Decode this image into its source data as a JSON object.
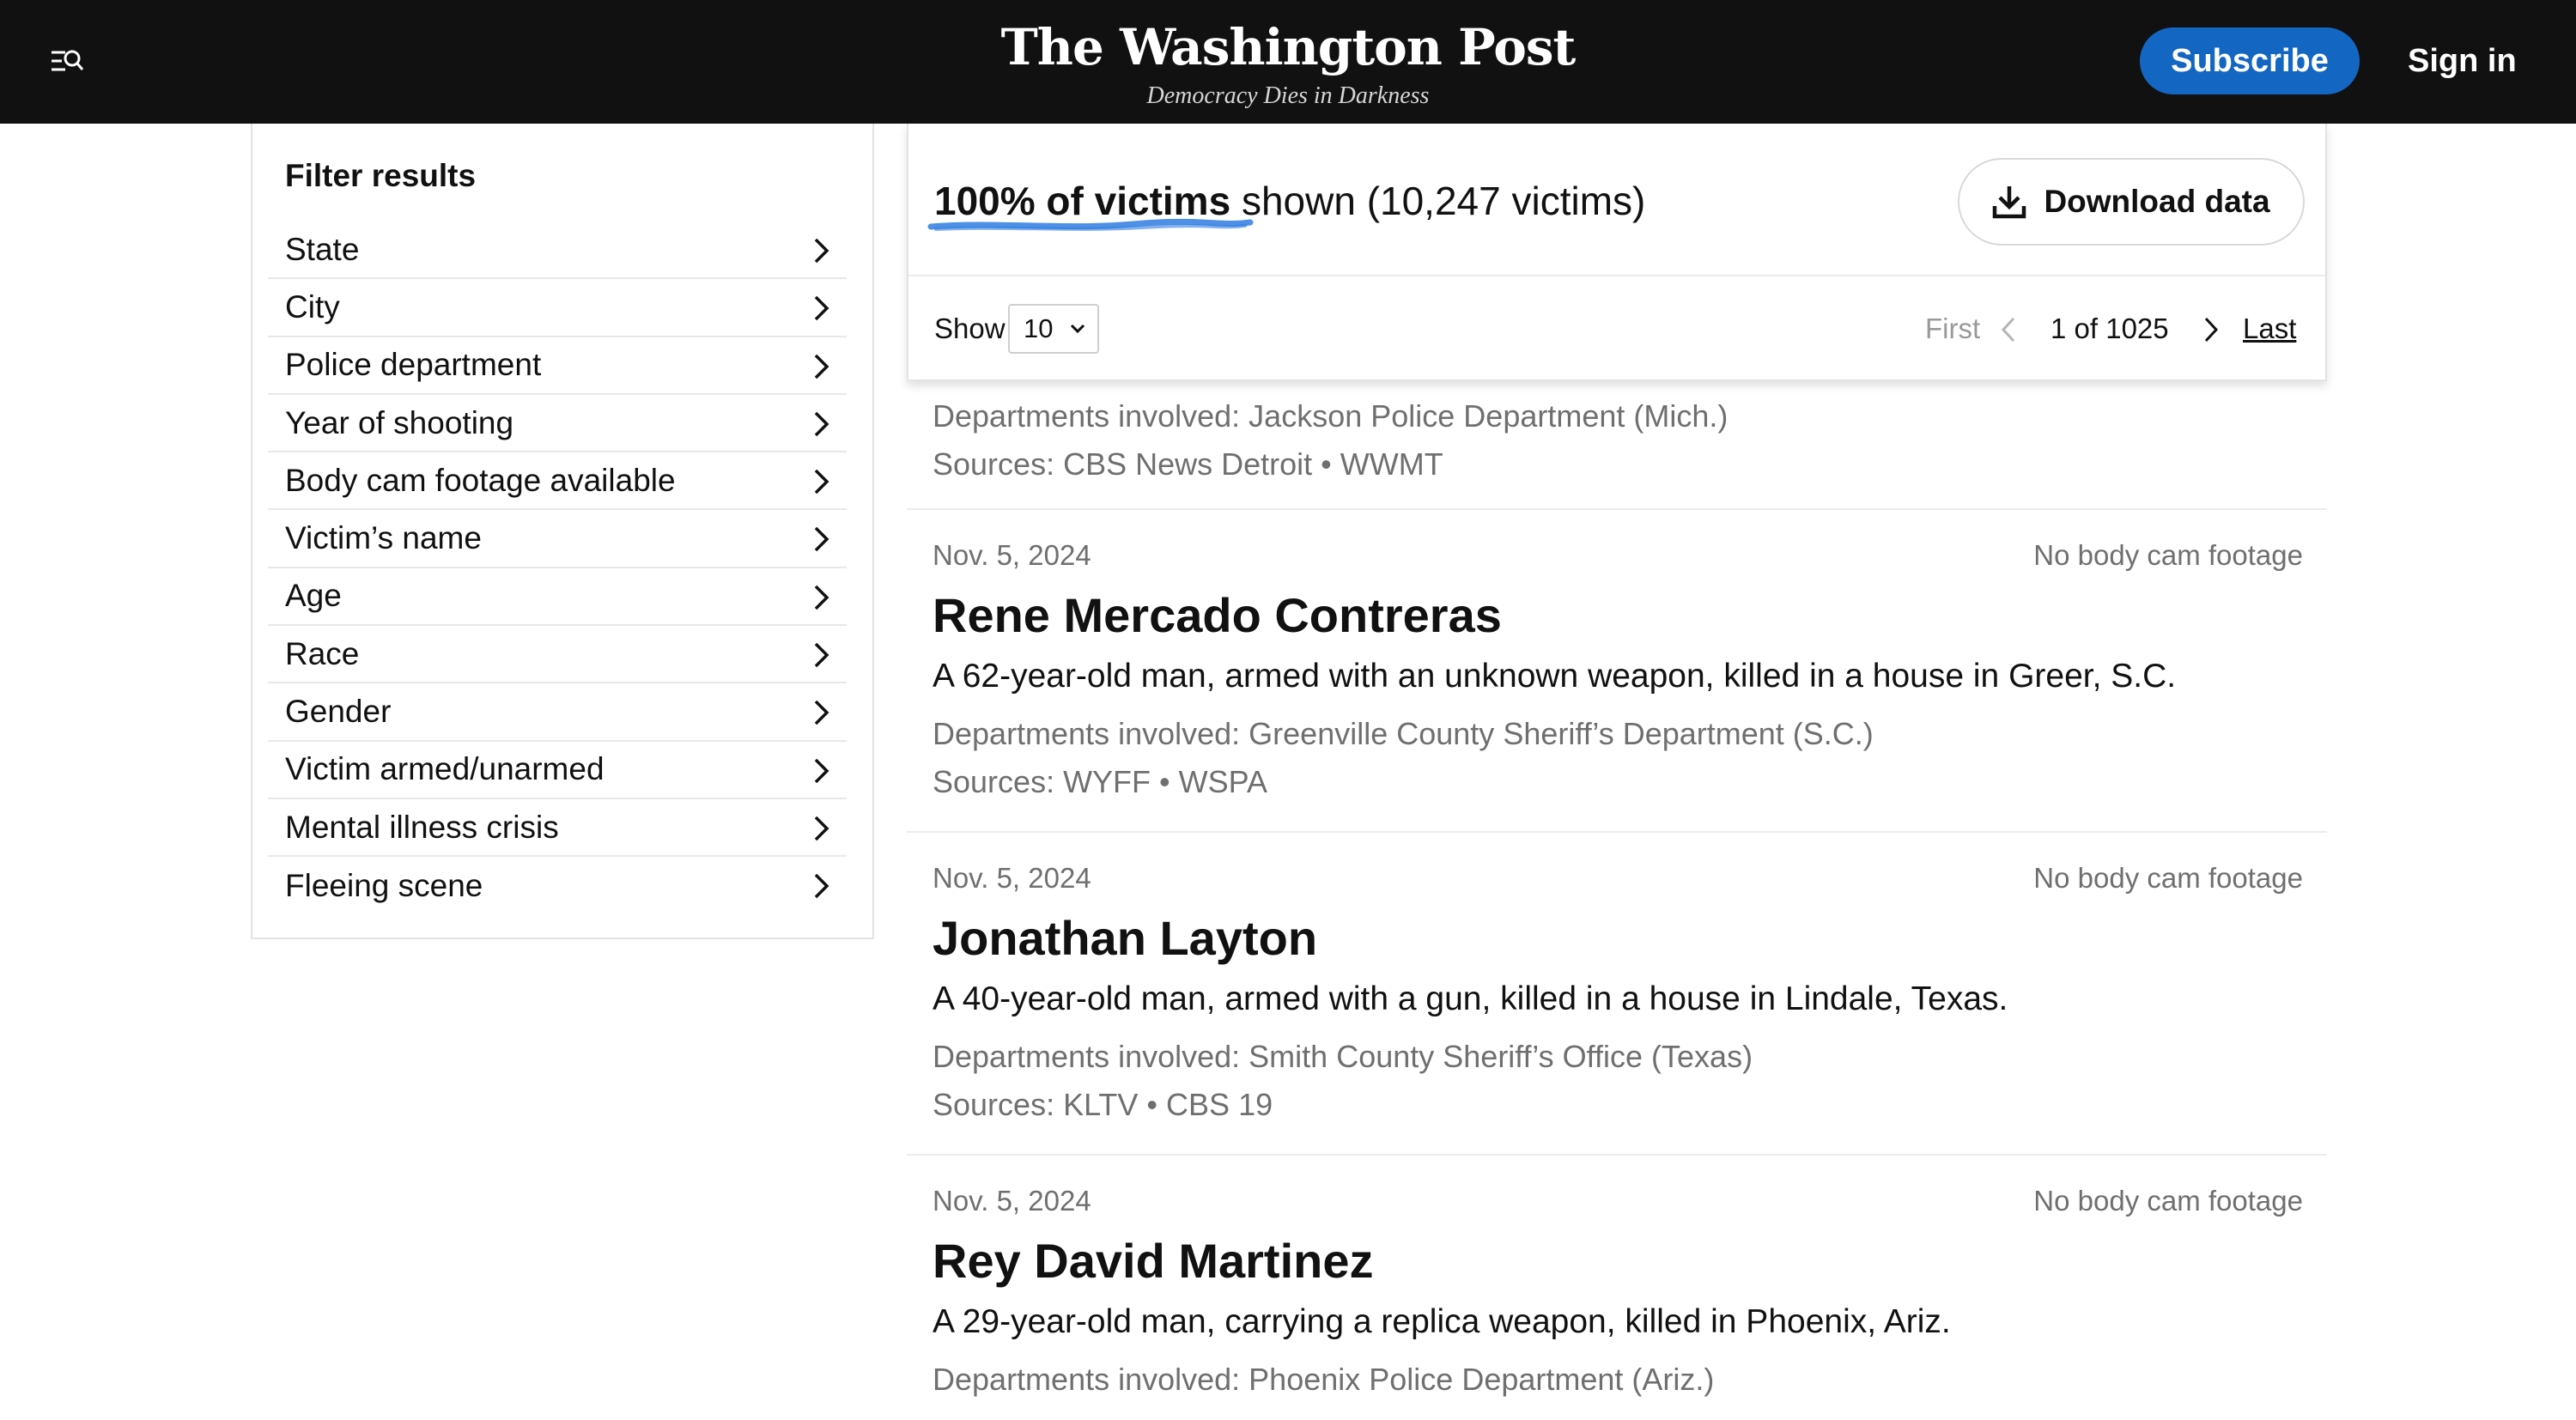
{
  "header": {
    "wordmark": "The Washington Post",
    "tagline": "Democracy Dies in Darkness",
    "subscribe_label": "Subscribe",
    "signin_label": "Sign in",
    "accent": "#1366c2"
  },
  "filters": {
    "title": "Filter results",
    "items": [
      "State",
      "City",
      "Police department",
      "Year of shooting",
      "Body cam footage available",
      "Victim’s name",
      "Age",
      "Race",
      "Gender",
      "Victim armed/unarmed",
      "Mental illness crisis",
      "Fleeing scene"
    ]
  },
  "summary": {
    "pct_label": "100% of victims",
    "shown_text": " shown (10,247 victims)",
    "download_label": "Download data",
    "show_label": "Show",
    "show_value": "10",
    "first_label": "First",
    "page_status": "1 of 1025",
    "last_label": "Last"
  },
  "partial_entry": {
    "departments": "Departments involved: Jackson Police Department (Mich.)",
    "sources": "Sources: CBS News Detroit • WWMT"
  },
  "entries": [
    {
      "date": "Nov. 5, 2024",
      "body_cam": "No body cam footage",
      "name": "Rene Mercado Contreras",
      "description": "A 62-year-old man, armed with an unknown weapon, killed in a house in Greer, S.C.",
      "departments": "Departments involved: Greenville County Sheriff’s Department (S.C.)",
      "sources": "Sources: WYFF • WSPA"
    },
    {
      "date": "Nov. 5, 2024",
      "body_cam": "No body cam footage",
      "name": "Jonathan Layton",
      "description": "A 40-year-old man, armed with a gun, killed in a house in Lindale, Texas.",
      "departments": "Departments involved: Smith County Sheriff’s Office (Texas)",
      "sources": "Sources: KLTV • CBS 19"
    },
    {
      "date": "Nov. 5, 2024",
      "body_cam": "No body cam footage",
      "name": "Rey David Martinez",
      "description": "A 29-year-old man, carrying a replica weapon, killed in Phoenix, Ariz.",
      "departments": "Departments involved: Phoenix Police Department (Ariz.)",
      "sources": ""
    }
  ]
}
